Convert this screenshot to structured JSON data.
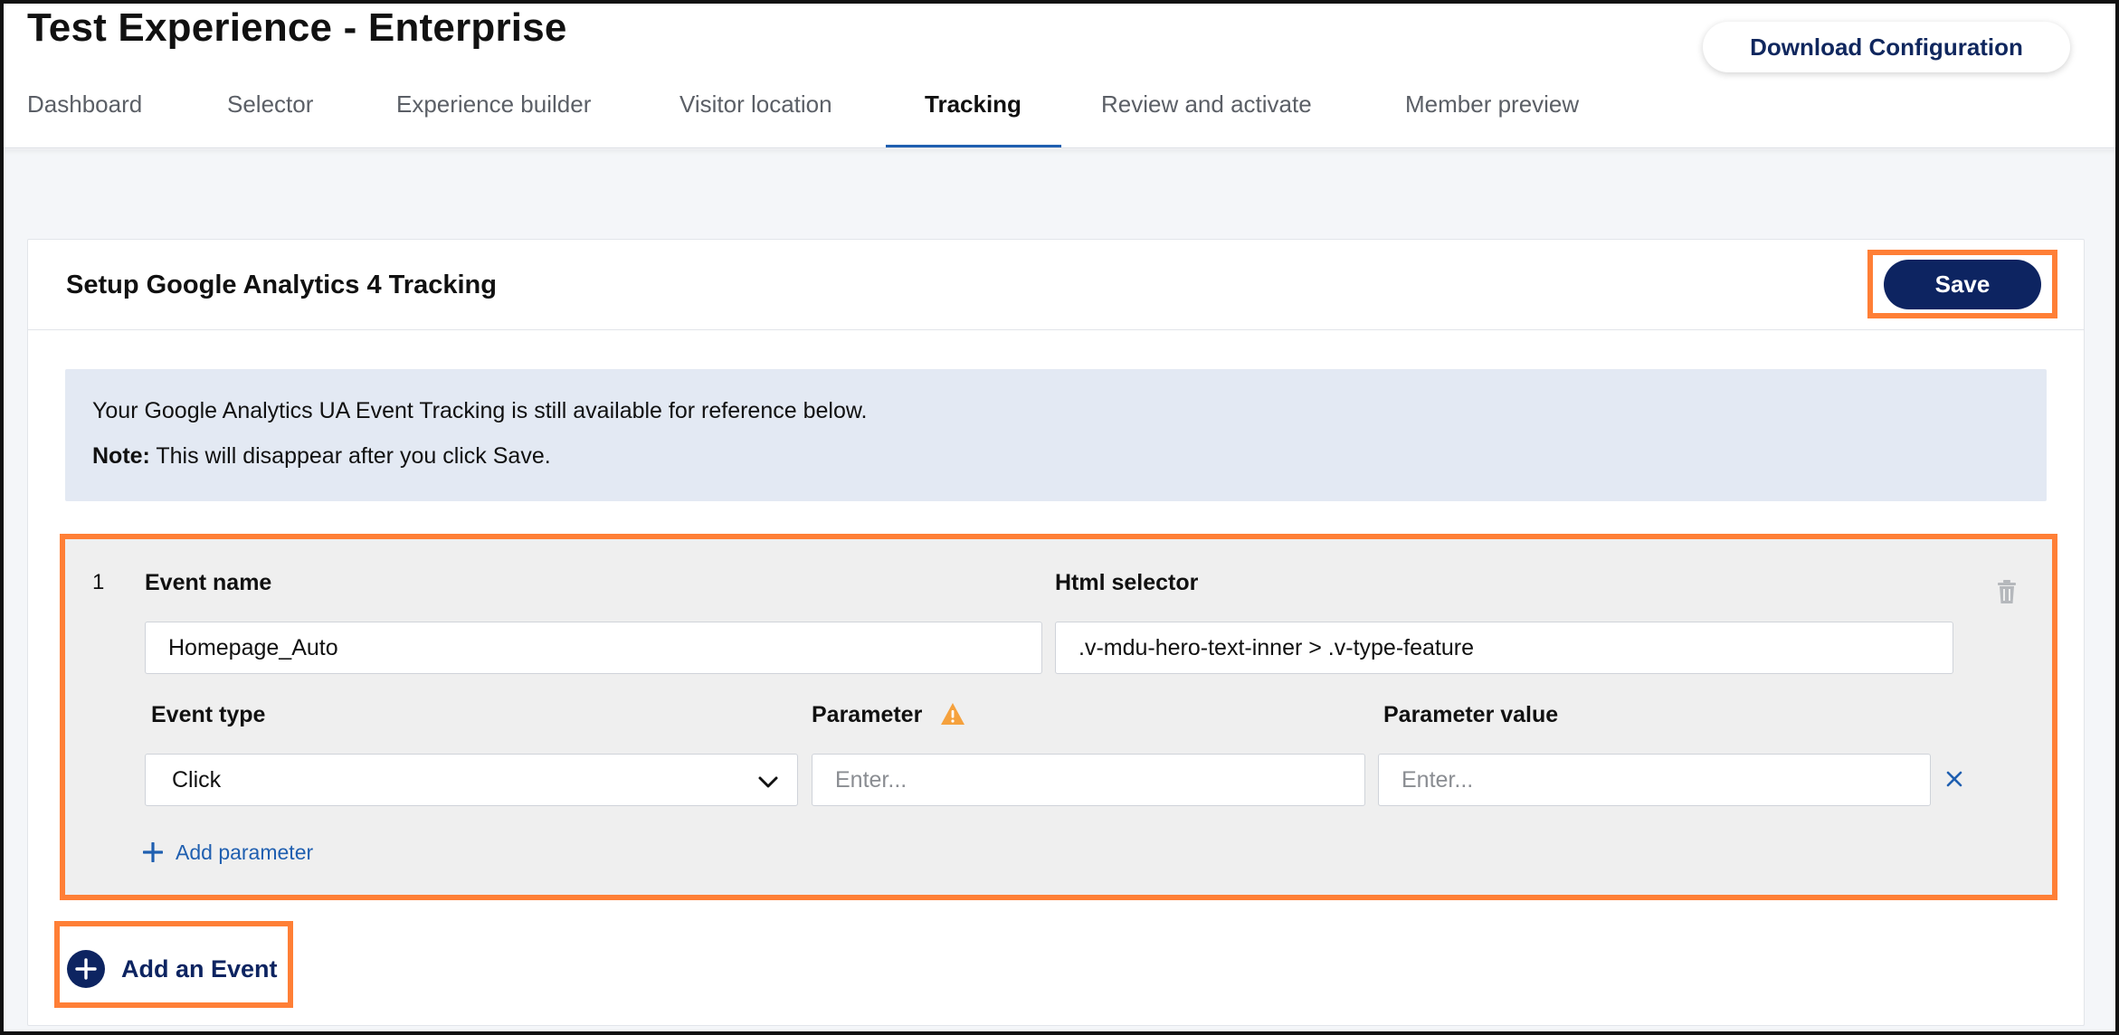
{
  "header": {
    "title": "Test Experience - Enterprise",
    "download_label": "Download Configuration"
  },
  "tabs": [
    {
      "label": "Dashboard",
      "active": false
    },
    {
      "label": "Selector",
      "active": false
    },
    {
      "label": "Experience builder",
      "active": false
    },
    {
      "label": "Visitor location",
      "active": false
    },
    {
      "label": "Tracking",
      "active": true
    },
    {
      "label": "Review and activate",
      "active": false
    },
    {
      "label": "Member preview",
      "active": false
    }
  ],
  "card": {
    "title": "Setup Google Analytics 4 Tracking",
    "save_label": "Save"
  },
  "notice": {
    "line1": "Your Google Analytics UA Event Tracking is still available for reference below.",
    "note_label": "Note:",
    "note_text": " This will disappear after you click Save."
  },
  "event": {
    "number": "1",
    "event_name_label": "Event name",
    "event_name_value": "Homepage_Auto",
    "html_selector_label": "Html selector",
    "html_selector_value": ".v-mdu-hero-text-inner > .v-type-feature",
    "event_type_label": "Event type",
    "event_type_value": "Click",
    "parameter_label": "Parameter",
    "parameter_placeholder": "Enter...",
    "parameter_value_label": "Parameter value",
    "parameter_value_placeholder": "Enter...",
    "add_parameter_label": "Add parameter"
  },
  "add_event_label": "Add an Event",
  "colors": {
    "navy": "#0d2461",
    "link_blue": "#1f5fb0",
    "highlight_orange": "#ff7f36",
    "warning_orange": "#f5a13d",
    "notice_bg": "#e3e9f3"
  },
  "icons": [
    "chevron-down-icon",
    "warning-icon",
    "trash-icon",
    "close-icon",
    "plus-icon",
    "plus-circle-icon"
  ]
}
